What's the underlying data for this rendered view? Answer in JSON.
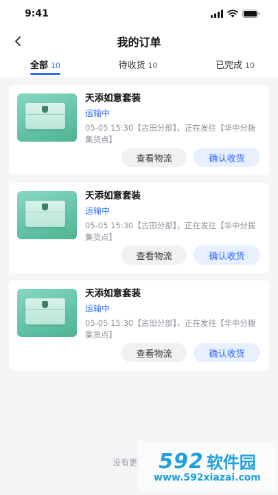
{
  "status_bar": {
    "time": "9:41"
  },
  "navbar": {
    "title": "我的订单"
  },
  "tabs": [
    {
      "label": "全部",
      "count": "10",
      "active": true
    },
    {
      "label": "待收货",
      "count": "10",
      "active": false
    },
    {
      "label": "已完成",
      "count": "10",
      "active": false
    }
  ],
  "orders": [
    {
      "name": "天添如意套装",
      "status": "运输中",
      "tracking": "05-05 15:30【古田分部】，正在发往【华中分拨集货点】",
      "btn_logistics": "查看物流",
      "btn_confirm": "确认收货"
    },
    {
      "name": "天添如意套装",
      "status": "运输中",
      "tracking": "05-05 15:30【古田分部】，正在发往【华中分拨集货点】",
      "btn_logistics": "查看物流",
      "btn_confirm": "确认收货"
    },
    {
      "name": "天添如意套装",
      "status": "运输中",
      "tracking": "05-05 15:30【古田分部】，正在发往【华中分拨集货点】",
      "btn_logistics": "查看物流",
      "btn_confirm": "确认收货"
    }
  ],
  "footer": {
    "text": "没有更"
  },
  "watermark": {
    "logo_num": "592",
    "logo_cn": "软件园",
    "url": "www.592xiazai.com"
  },
  "colors": {
    "accent": "#2f6bff",
    "background": "#f4f5f7",
    "card": "#ffffff",
    "product_bg": "#63c2a6"
  },
  "icons": {
    "back": "chevron-left-icon",
    "signal": "signal-icon",
    "wifi": "wifi-icon",
    "battery": "battery-icon"
  }
}
